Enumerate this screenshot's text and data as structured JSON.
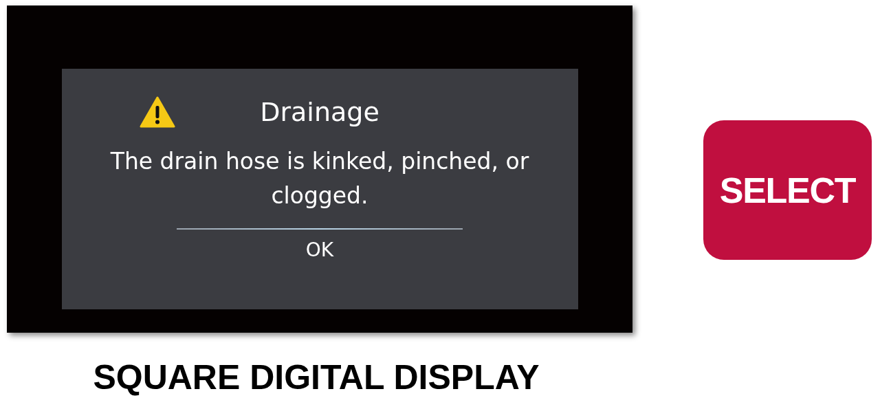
{
  "dialog": {
    "title": "Drainage",
    "message": "The drain hose is kinked, pinched, or clogged.",
    "button": "OK"
  },
  "caption": "SQUARE DIGITAL DISPLAY",
  "select_button": "SELECT"
}
